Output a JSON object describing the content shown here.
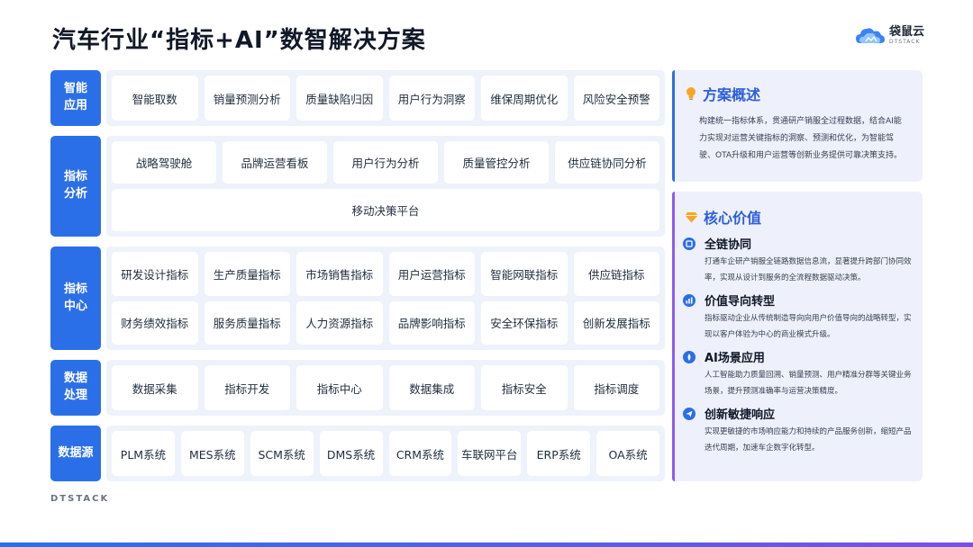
{
  "title": "汽车行业“指标+AI”数智解决方案",
  "logo": {
    "cn": "袋鼠云",
    "en": "DTSTACK"
  },
  "footer_logo": "DTSTACK",
  "layers": {
    "app": {
      "label": "智能\n应用",
      "rows": [
        [
          "智能取数",
          "销量预测分析",
          "质量缺陷归因",
          "用户行为洞察",
          "维保周期优化",
          "风险安全预警"
        ]
      ]
    },
    "analysis": {
      "label": "指标\n分析",
      "rows": [
        [
          "战略驾驶舱",
          "品牌运营看板",
          "用户行为分析",
          "质量管控分析",
          "供应链协同分析"
        ],
        [
          "移动决策平台"
        ]
      ]
    },
    "center": {
      "label": "指标\n中心",
      "rows": [
        [
          "研发设计指标",
          "生产质量指标",
          "市场销售指标",
          "用户运营指标",
          "智能网联指标",
          "供应链指标"
        ],
        [
          "财务绩效指标",
          "服务质量指标",
          "人力资源指标",
          "品牌影响指标",
          "安全环保指标",
          "创新发展指标"
        ]
      ]
    },
    "process": {
      "label": "数据\n处理",
      "rows": [
        [
          "数据采集",
          "指标开发",
          "指标中心",
          "数据集成",
          "指标安全",
          "指标调度"
        ]
      ]
    },
    "source": {
      "label": "数据源",
      "rows": [
        [
          "PLM系统",
          "MES系统",
          "SCM系统",
          "DMS系统",
          "CRM系统",
          "车联网平台",
          "ERP系统",
          "OA系统"
        ]
      ]
    }
  },
  "overview": {
    "title": "方案概述",
    "text": "构建统一指标体系，贯通研产销服全过程数据，结合AI能力实现对运营关键指标的洞察、预测和优化，为智能驾驶、OTA升级和用户运营等创新业务提供可靠决策支持。"
  },
  "values": {
    "title": "核心价值",
    "items": [
      {
        "icon": "chain-icon",
        "title": "全链协同",
        "desc": "打通车企研产销服全链路数据信息流，显著提升跨部门协同效率，实现从设计到服务的全流程数据驱动决策。"
      },
      {
        "icon": "chart-icon",
        "title": "价值导向转型",
        "desc": "指标驱动企业从传统制造导向向用户价值导向的战略转型，实现以客户体验为中心的商业模式升级。"
      },
      {
        "icon": "ai-icon",
        "title": "AI场景应用",
        "desc": "人工智能助力质量回溯、销量预测、用户精准分群等关键业务场景，提升预测准确率与运营决策精度。"
      },
      {
        "icon": "send-icon",
        "title": "创新敏捷响应",
        "desc": "实现更敏捷的市场响应能力和持续的产品服务创新，缩短产品迭代周期，加速车企数字化转型。"
      }
    ]
  },
  "colors": {
    "primary": "#2b6fe8",
    "panel_bg": "#eef0fb",
    "layer_bg": "#eef2fa",
    "accent_gold": "#f5a623",
    "accent_purple": "#8b5cf6"
  }
}
